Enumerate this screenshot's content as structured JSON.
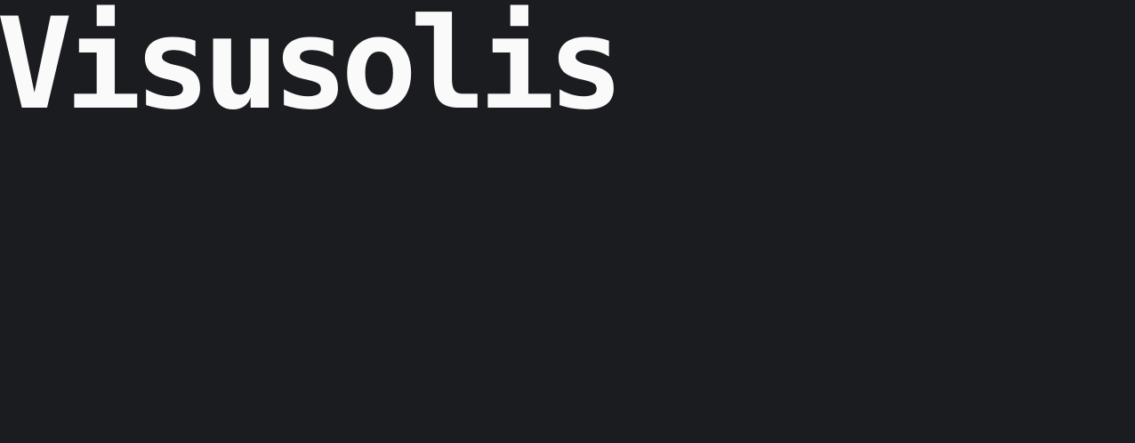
{
  "header": {
    "title": "Visusolis"
  },
  "colors": {
    "background": "#1b1c20",
    "title_text": "#fafafa"
  }
}
